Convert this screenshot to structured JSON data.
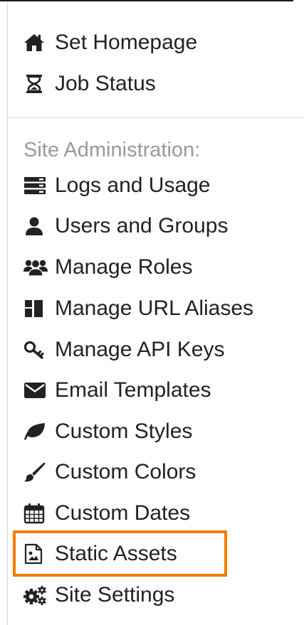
{
  "menu": {
    "top_items": [
      {
        "label": "Set Homepage",
        "icon": "home-icon"
      },
      {
        "label": "Job Status",
        "icon": "hourglass-icon"
      }
    ],
    "section_header": "Site Administration:",
    "admin_items": [
      {
        "label": "Logs and Usage",
        "icon": "server-icon"
      },
      {
        "label": "Users and Groups",
        "icon": "user-icon"
      },
      {
        "label": "Manage Roles",
        "icon": "users-icon"
      },
      {
        "label": "Manage URL Aliases",
        "icon": "grid-icon"
      },
      {
        "label": "Manage API Keys",
        "icon": "key-icon"
      },
      {
        "label": "Email Templates",
        "icon": "envelope-icon"
      },
      {
        "label": "Custom Styles",
        "icon": "leaf-icon"
      },
      {
        "label": "Custom Colors",
        "icon": "paint-brush-icon"
      },
      {
        "label": "Custom Dates",
        "icon": "calendar-icon"
      },
      {
        "label": "Static Assets",
        "icon": "image-file-icon"
      },
      {
        "label": "Site Settings",
        "icon": "cogs-icon"
      }
    ]
  },
  "highlight": {
    "target": "Static Assets",
    "color": "#f57c00"
  }
}
